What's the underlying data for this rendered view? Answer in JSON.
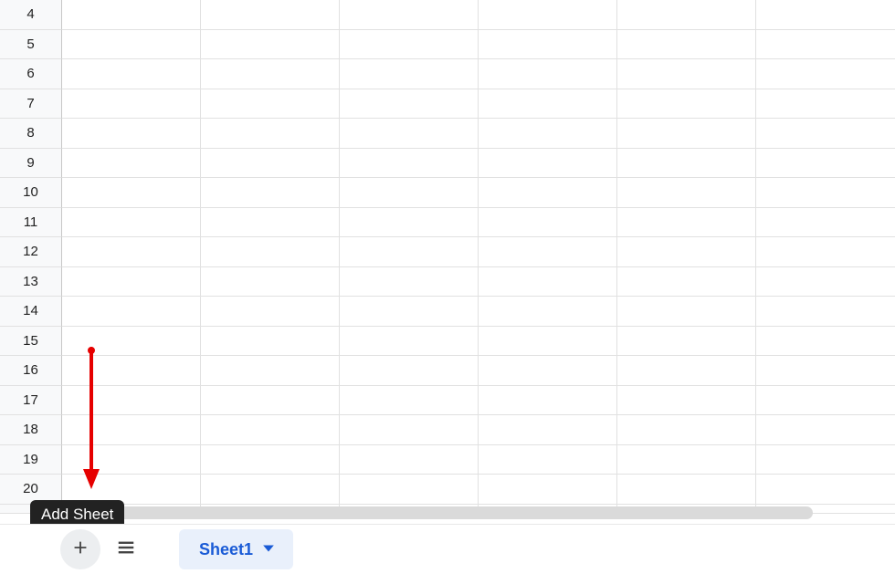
{
  "rows": [
    "4",
    "5",
    "6",
    "7",
    "8",
    "9",
    "10",
    "11",
    "12",
    "13",
    "14",
    "15",
    "16",
    "17",
    "18",
    "19",
    "20"
  ],
  "tooltip": {
    "text": "Add Sheet"
  },
  "tabs": {
    "active_label": "Sheet1"
  }
}
